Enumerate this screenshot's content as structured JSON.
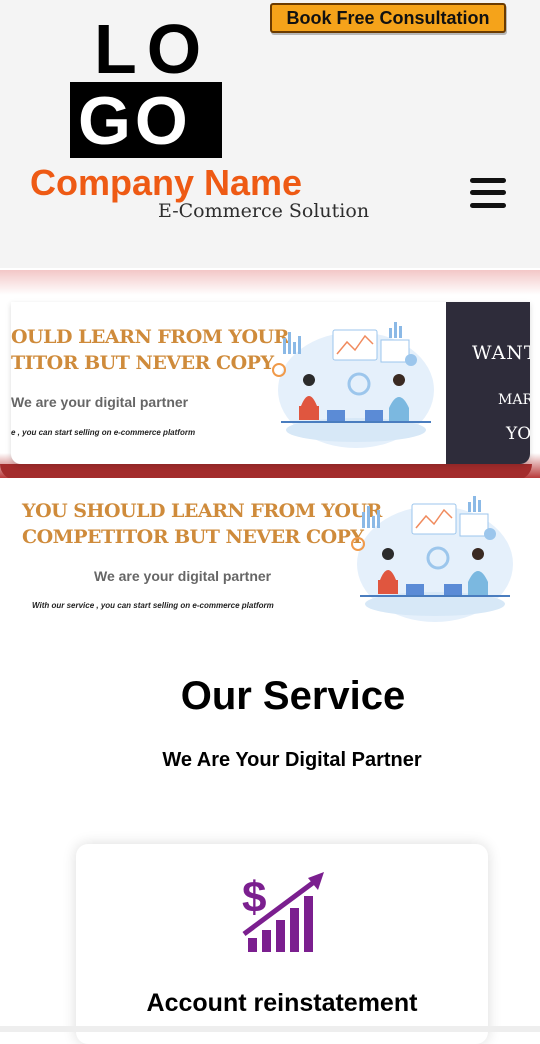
{
  "header": {
    "cta_label": "Book Free Consultation",
    "logo_top": "LO",
    "logo_bottom": "GO",
    "company_name": "Company Name",
    "tagline": "E-Commerce Solution",
    "menu_icon": "hamburger-menu-icon"
  },
  "slider": {
    "slide1": {
      "headline_line1": "OULD LEARN FROM YOUR",
      "headline_line2": "TITOR BUT NEVER COPY",
      "subtitle": "We are your digital partner",
      "small_text": "e , you can start selling on e-commerce platform"
    },
    "slide2_peek": {
      "line1": "WANT",
      "line2": "MAR",
      "line3": "YO"
    }
  },
  "banner": {
    "headline_line1": "YOU SHOULD LEARN FROM YOUR",
    "headline_line2": "COMPETITOR BUT NEVER COPY",
    "subtitle": "We are your digital partner",
    "small_text": "With our service , you can start selling on e-commerce platform"
  },
  "services": {
    "title": "Our Service",
    "subtitle": "We Are Your Digital Partner",
    "cards": [
      {
        "title": "Account reinstatement",
        "icon": "dollar-growth-chart-icon"
      }
    ]
  },
  "colors": {
    "accent_orange": "#ee5a14",
    "cta_yellow": "#f5a31a",
    "headline_gold": "#cf8b3b",
    "icon_purple": "#7b1f8f",
    "slider_red": "#a32c2c"
  }
}
